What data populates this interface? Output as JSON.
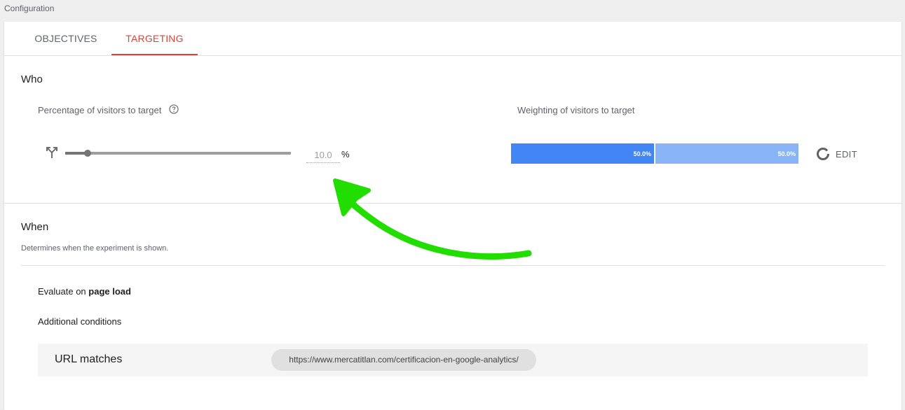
{
  "page": {
    "heading": "Configuration"
  },
  "tabs": [
    {
      "label": "OBJECTIVES",
      "active": false
    },
    {
      "label": "TARGETING",
      "active": true
    }
  ],
  "who": {
    "title": "Who",
    "percentage_label": "Percentage of visitors to target",
    "slider_fraction": 0.1,
    "percentage_value": "10.0",
    "percent_symbol": "%",
    "weighting_label": "Weighting of visitors to target",
    "weights": [
      "50.0%",
      "50.0%"
    ],
    "edit_label": "EDIT"
  },
  "when": {
    "title": "When",
    "description": "Determines when the experiment is shown.",
    "evaluate_prefix": "Evaluate on ",
    "evaluate_value": "page load",
    "additional_conditions": "Additional conditions",
    "url_condition_label": "URL matches",
    "url_value": "https://www.mercatitlan.com/certificacion-en-google-analytics/"
  },
  "colors": {
    "accent_red": "#db4437",
    "weight_primary": "#4285f4",
    "weight_secondary": "#8ab4f8",
    "annotation_green": "#22dd00"
  },
  "icons": [
    "help-icon",
    "split-traffic-icon",
    "pie-chart-icon"
  ]
}
